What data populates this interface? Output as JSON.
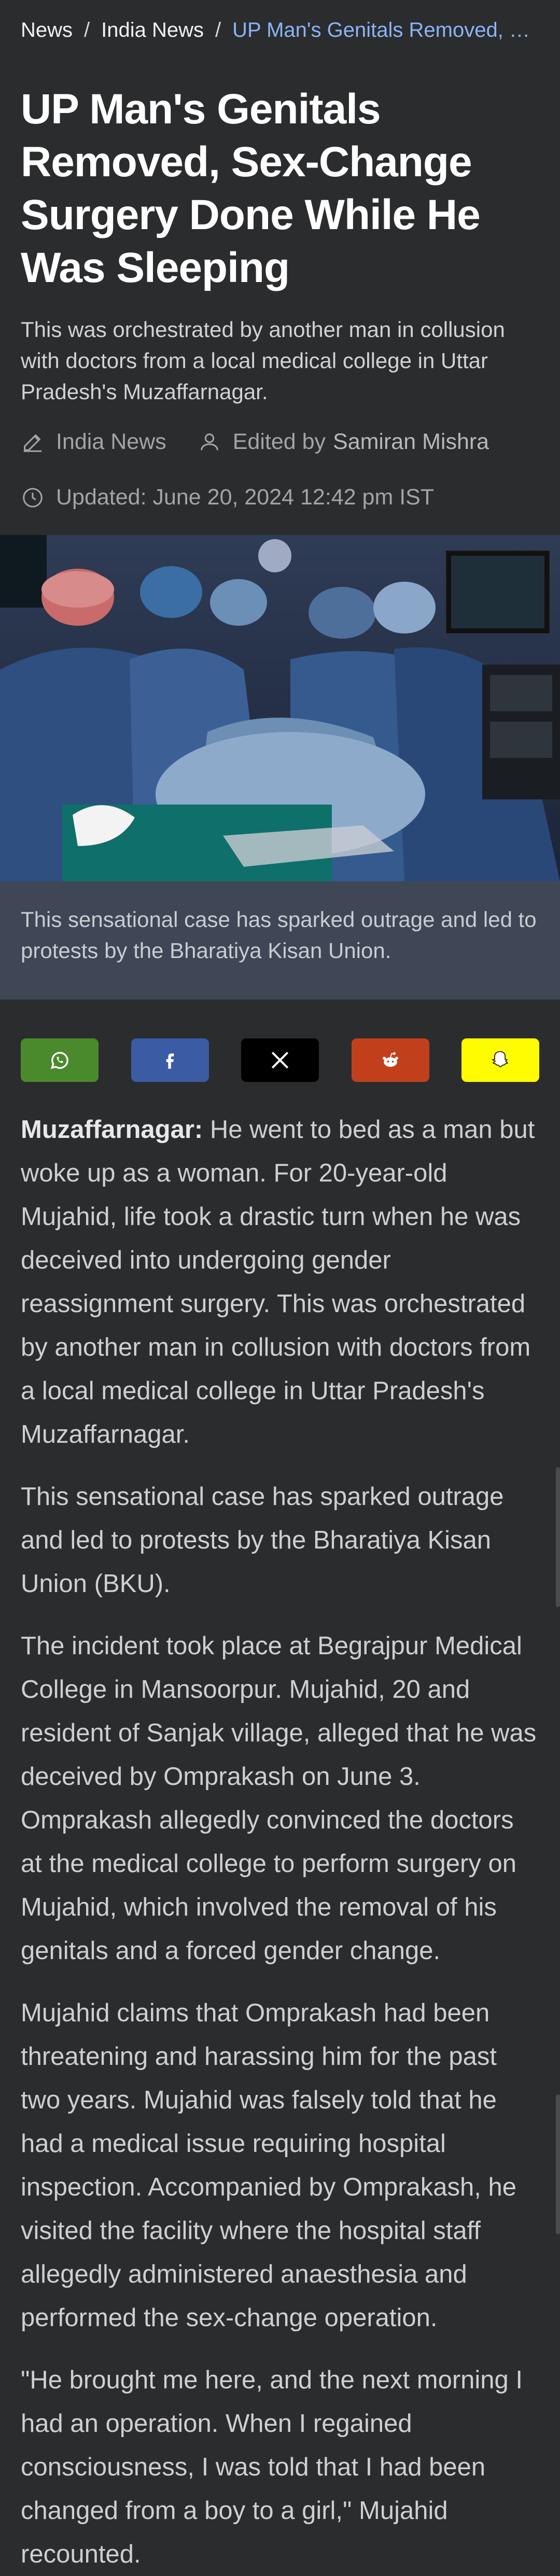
{
  "breadcrumb": {
    "home": "News",
    "section": "India News",
    "current": "UP Man's Genitals Removed, Sex-Change Surgery Done While He Was Sleeping"
  },
  "article": {
    "title": "UP Man's Genitals Removed, Sex-Change Surgery Done While He Was Sleeping",
    "summary": "This was orchestrated by another man in collusion with doctors from a local medical college in Uttar Pradesh's Muzaffarnagar.",
    "category": "India News",
    "edited_by_label": "Edited by",
    "editor": "Samiran Mishra",
    "updated": "Updated: June 20, 2024 12:42 pm IST",
    "image_caption": "This sensational case has sparked outrage and led to protests by the Bharatiya Kisan Union.",
    "dateline": "Muzaffarnagar:",
    "paragraphs": [
      "He went to bed as a man but woke up as a woman. For 20-year-old Mujahid, life took a drastic turn when he was deceived into undergoing gender reassignment surgery. This was orchestrated by another man in collusion with doctors from a local medical college in Uttar Pradesh's Muzaffarnagar.",
      "This sensational case has sparked outrage and led to protests by the Bharatiya Kisan Union (BKU).",
      "The incident took place at Begrajpur Medical College in Mansoorpur. Mujahid, 20 and resident of Sanjak village, alleged that he was deceived by Omprakash on June 3. Omprakash allegedly convinced the doctors at the medical college to perform surgery on Mujahid, which involved the removal of his genitals and a forced gender change.",
      "Mujahid claims that Omprakash had been threatening and harassing him for the past two years. Mujahid was falsely told that he had a medical issue requiring hospital inspection. Accompanied by Omprakash, he visited the facility where the hospital staff allegedly administered anaesthesia and performed the sex-change operation.",
      "\"He brought me here, and the next morning I had an operation. When I regained consciousness, I was told that I had been changed from a boy to a girl,\" Mujahid recounted."
    ]
  },
  "share": [
    {
      "name": "whatsapp",
      "color": "#4a8a2c"
    },
    {
      "name": "facebook",
      "color": "#3b5ba5"
    },
    {
      "name": "x",
      "color": "#000000"
    },
    {
      "name": "reddit",
      "color": "#c1401b"
    },
    {
      "name": "snapchat",
      "color": "#fffc00"
    }
  ],
  "icons": {
    "category": "pencil-icon",
    "editor": "user-icon",
    "updated": "clock-icon"
  }
}
